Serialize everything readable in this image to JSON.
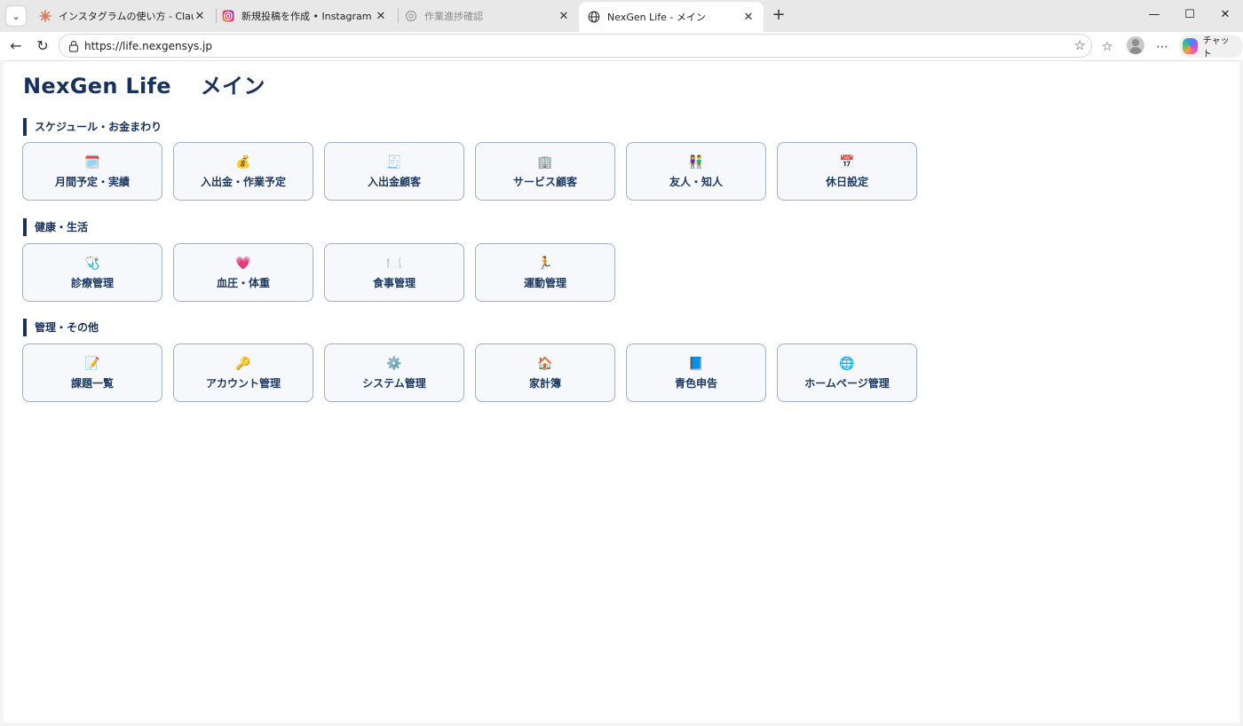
{
  "browser": {
    "tabs": [
      {
        "title": "インスタグラムの使い方 - Claude",
        "icon": "claude-logo",
        "active": false,
        "dim": false
      },
      {
        "title": "新規投稿を作成 • Instagram",
        "icon": "instagram-logo",
        "active": false,
        "dim": false
      },
      {
        "title": "作業進捗確認",
        "icon": "openai-logo",
        "active": false,
        "dim": true
      },
      {
        "title": "NexGen Life - メイン",
        "icon": "globe-icon",
        "active": true,
        "dim": false
      }
    ],
    "url": "https://life.nexgensys.jp",
    "copilot_label": "チャット"
  },
  "page": {
    "title": "NexGen Life　 メイン",
    "sections": [
      {
        "heading": "スケジュール・お金まわり",
        "items": [
          {
            "icon": "🗓️",
            "label": "月間予定・実績"
          },
          {
            "icon": "💰",
            "label": "入出金・作業予定"
          },
          {
            "icon": "🧾",
            "label": "入出金顧客"
          },
          {
            "icon": "🏢",
            "label": "サービス顧客"
          },
          {
            "icon": "👫",
            "label": "友人・知人"
          },
          {
            "icon": "📅",
            "label": "休日設定"
          }
        ]
      },
      {
        "heading": "健康・生活",
        "items": [
          {
            "icon": "🩺",
            "label": "診療管理"
          },
          {
            "icon": "💗",
            "label": "血圧・体重"
          },
          {
            "icon": "🍽️",
            "label": "食事管理"
          },
          {
            "icon": "🏃",
            "label": "運動管理"
          }
        ]
      },
      {
        "heading": "管理・その他",
        "items": [
          {
            "icon": "📝",
            "label": "課題一覧"
          },
          {
            "icon": "🔑",
            "label": "アカウント管理"
          },
          {
            "icon": "⚙️",
            "label": "システム管理"
          },
          {
            "icon": "🏠",
            "label": "家計簿"
          },
          {
            "icon": "📘",
            "label": "青色申告"
          },
          {
            "icon": "🌐",
            "label": "ホームページ管理"
          }
        ]
      }
    ]
  }
}
